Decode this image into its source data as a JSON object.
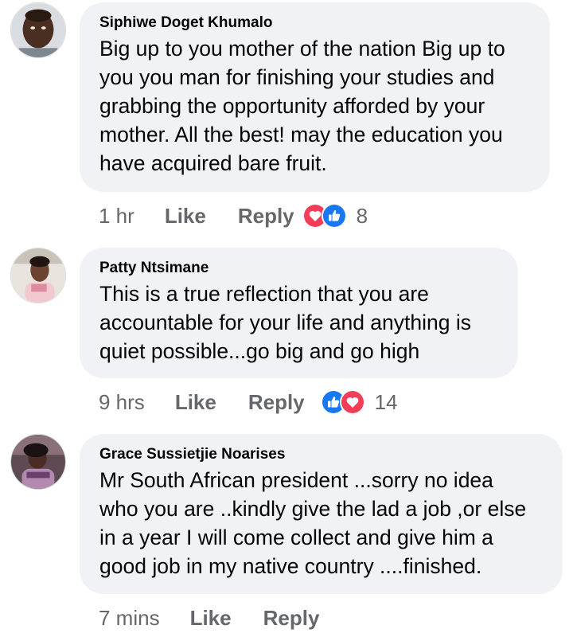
{
  "comments": [
    {
      "author": "Siphiwe Doget Khumalo",
      "text": "Big up to you mother of the nation Big up to\nyou you man for finishing your studies and\ngrabbing the opportunity afforded by your\nmother. All the best! may the education you\nhave acquired bare fruit.",
      "time": "1 hr",
      "like_label": "Like",
      "reply_label": "Reply",
      "reactions": [
        "love-reaction-icon",
        "like-reaction-icon"
      ],
      "reaction_count": "8"
    },
    {
      "author": "Patty Ntsimane",
      "text": "This is a true reflection that you are\naccountable for your life and anything is\nquiet possible...go big and go high",
      "time": "9 hrs",
      "like_label": "Like",
      "reply_label": "Reply",
      "reactions": [
        "like-reaction-icon",
        "love-reaction-icon"
      ],
      "reaction_count": "14"
    },
    {
      "author": "Grace Sussietjie Noarises",
      "text": "Mr South African president ...sorry no idea\nwho you are ..kindly give the lad a job ,or else\nin a year I will come collect and give him a\ngood job in my native country ....finished.",
      "time": "7 mins",
      "like_label": "Like",
      "reply_label": "Reply"
    }
  ],
  "colors": {
    "bubble": "#f0f2f5",
    "meta_text": "#65676b",
    "like_blue": "#1877f2",
    "love_red": "#f33e58"
  }
}
